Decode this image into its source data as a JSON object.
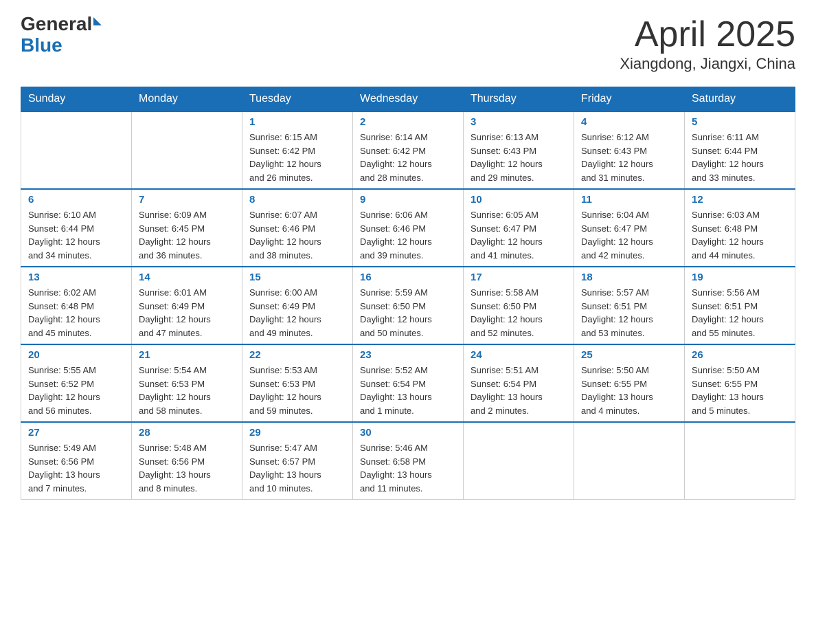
{
  "header": {
    "logo_general": "General",
    "logo_blue": "Blue",
    "title": "April 2025",
    "subtitle": "Xiangdong, Jiangxi, China"
  },
  "weekdays": [
    "Sunday",
    "Monday",
    "Tuesday",
    "Wednesday",
    "Thursday",
    "Friday",
    "Saturday"
  ],
  "weeks": [
    [
      {
        "day": "",
        "info": ""
      },
      {
        "day": "",
        "info": ""
      },
      {
        "day": "1",
        "info": "Sunrise: 6:15 AM\nSunset: 6:42 PM\nDaylight: 12 hours\nand 26 minutes."
      },
      {
        "day": "2",
        "info": "Sunrise: 6:14 AM\nSunset: 6:42 PM\nDaylight: 12 hours\nand 28 minutes."
      },
      {
        "day": "3",
        "info": "Sunrise: 6:13 AM\nSunset: 6:43 PM\nDaylight: 12 hours\nand 29 minutes."
      },
      {
        "day": "4",
        "info": "Sunrise: 6:12 AM\nSunset: 6:43 PM\nDaylight: 12 hours\nand 31 minutes."
      },
      {
        "day": "5",
        "info": "Sunrise: 6:11 AM\nSunset: 6:44 PM\nDaylight: 12 hours\nand 33 minutes."
      }
    ],
    [
      {
        "day": "6",
        "info": "Sunrise: 6:10 AM\nSunset: 6:44 PM\nDaylight: 12 hours\nand 34 minutes."
      },
      {
        "day": "7",
        "info": "Sunrise: 6:09 AM\nSunset: 6:45 PM\nDaylight: 12 hours\nand 36 minutes."
      },
      {
        "day": "8",
        "info": "Sunrise: 6:07 AM\nSunset: 6:46 PM\nDaylight: 12 hours\nand 38 minutes."
      },
      {
        "day": "9",
        "info": "Sunrise: 6:06 AM\nSunset: 6:46 PM\nDaylight: 12 hours\nand 39 minutes."
      },
      {
        "day": "10",
        "info": "Sunrise: 6:05 AM\nSunset: 6:47 PM\nDaylight: 12 hours\nand 41 minutes."
      },
      {
        "day": "11",
        "info": "Sunrise: 6:04 AM\nSunset: 6:47 PM\nDaylight: 12 hours\nand 42 minutes."
      },
      {
        "day": "12",
        "info": "Sunrise: 6:03 AM\nSunset: 6:48 PM\nDaylight: 12 hours\nand 44 minutes."
      }
    ],
    [
      {
        "day": "13",
        "info": "Sunrise: 6:02 AM\nSunset: 6:48 PM\nDaylight: 12 hours\nand 45 minutes."
      },
      {
        "day": "14",
        "info": "Sunrise: 6:01 AM\nSunset: 6:49 PM\nDaylight: 12 hours\nand 47 minutes."
      },
      {
        "day": "15",
        "info": "Sunrise: 6:00 AM\nSunset: 6:49 PM\nDaylight: 12 hours\nand 49 minutes."
      },
      {
        "day": "16",
        "info": "Sunrise: 5:59 AM\nSunset: 6:50 PM\nDaylight: 12 hours\nand 50 minutes."
      },
      {
        "day": "17",
        "info": "Sunrise: 5:58 AM\nSunset: 6:50 PM\nDaylight: 12 hours\nand 52 minutes."
      },
      {
        "day": "18",
        "info": "Sunrise: 5:57 AM\nSunset: 6:51 PM\nDaylight: 12 hours\nand 53 minutes."
      },
      {
        "day": "19",
        "info": "Sunrise: 5:56 AM\nSunset: 6:51 PM\nDaylight: 12 hours\nand 55 minutes."
      }
    ],
    [
      {
        "day": "20",
        "info": "Sunrise: 5:55 AM\nSunset: 6:52 PM\nDaylight: 12 hours\nand 56 minutes."
      },
      {
        "day": "21",
        "info": "Sunrise: 5:54 AM\nSunset: 6:53 PM\nDaylight: 12 hours\nand 58 minutes."
      },
      {
        "day": "22",
        "info": "Sunrise: 5:53 AM\nSunset: 6:53 PM\nDaylight: 12 hours\nand 59 minutes."
      },
      {
        "day": "23",
        "info": "Sunrise: 5:52 AM\nSunset: 6:54 PM\nDaylight: 13 hours\nand 1 minute."
      },
      {
        "day": "24",
        "info": "Sunrise: 5:51 AM\nSunset: 6:54 PM\nDaylight: 13 hours\nand 2 minutes."
      },
      {
        "day": "25",
        "info": "Sunrise: 5:50 AM\nSunset: 6:55 PM\nDaylight: 13 hours\nand 4 minutes."
      },
      {
        "day": "26",
        "info": "Sunrise: 5:50 AM\nSunset: 6:55 PM\nDaylight: 13 hours\nand 5 minutes."
      }
    ],
    [
      {
        "day": "27",
        "info": "Sunrise: 5:49 AM\nSunset: 6:56 PM\nDaylight: 13 hours\nand 7 minutes."
      },
      {
        "day": "28",
        "info": "Sunrise: 5:48 AM\nSunset: 6:56 PM\nDaylight: 13 hours\nand 8 minutes."
      },
      {
        "day": "29",
        "info": "Sunrise: 5:47 AM\nSunset: 6:57 PM\nDaylight: 13 hours\nand 10 minutes."
      },
      {
        "day": "30",
        "info": "Sunrise: 5:46 AM\nSunset: 6:58 PM\nDaylight: 13 hours\nand 11 minutes."
      },
      {
        "day": "",
        "info": ""
      },
      {
        "day": "",
        "info": ""
      },
      {
        "day": "",
        "info": ""
      }
    ]
  ]
}
